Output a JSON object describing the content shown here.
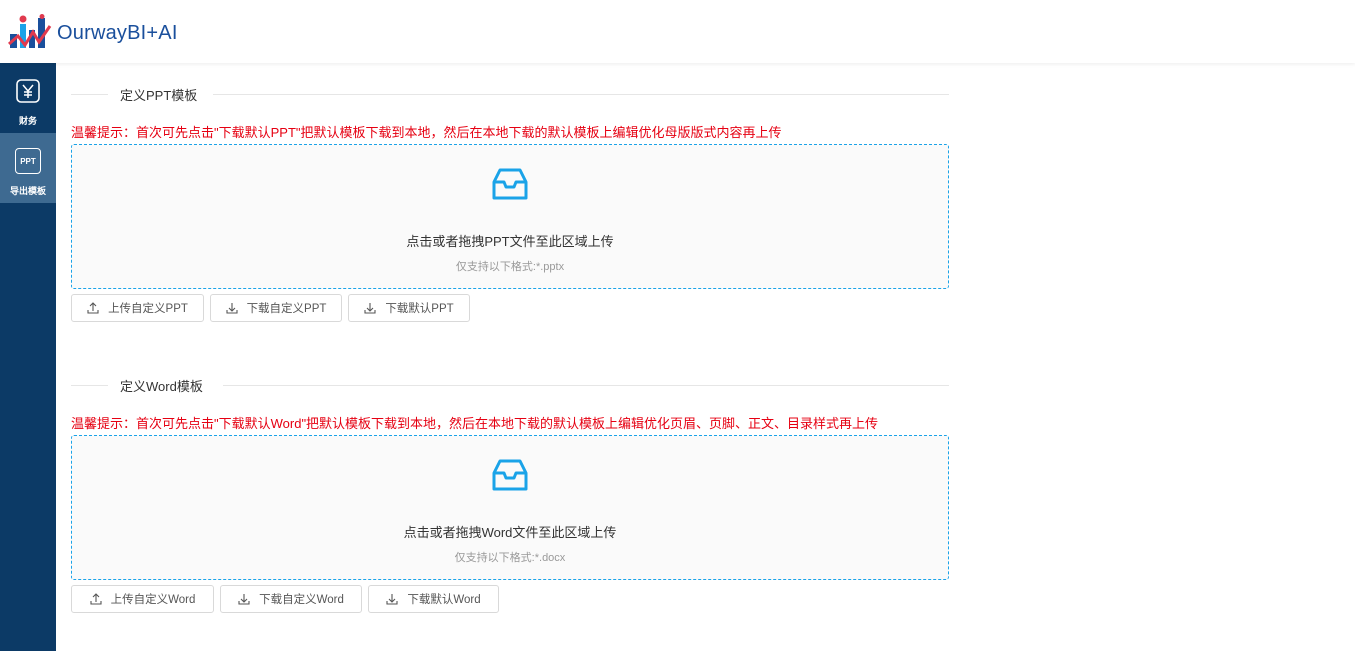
{
  "app": {
    "title": "OurwayBI+AI"
  },
  "sidebar": {
    "items": [
      {
        "label": "财务",
        "icon": "yuan-icon"
      },
      {
        "label": "导出模板",
        "icon": "ppt-icon",
        "icon_text": "PPT"
      }
    ]
  },
  "ppt_section": {
    "title": "定义PPT模板",
    "tip": "温馨提示：首次可先点击\"下载默认PPT\"把默认模板下载到本地，然后在本地下载的默认模板上编辑优化母版版式内容再上传",
    "upload_text": "点击或者拖拽PPT文件至此区域上传",
    "upload_hint": "仅支持以下格式:*.pptx",
    "buttons": [
      "上传自定义PPT",
      "下载自定义PPT",
      "下载默认PPT"
    ]
  },
  "word_section": {
    "title": "定义Word模板",
    "tip": "温馨提示：首次可先点击\"下载默认Word\"把默认模板下载到本地，然后在本地下载的默认模板上编辑优化页眉、页脚、正文、目录样式再上传",
    "upload_text": "点击或者拖拽Word文件至此区域上传",
    "upload_hint": "仅支持以下格式:*.docx",
    "buttons": [
      "上传自定义Word",
      "下载自定义Word",
      "下载默认Word"
    ]
  },
  "colors": {
    "sidebar_bg": "#0c3a66",
    "sidebar_active": "#3e6a91",
    "accent": "#1aa3e8",
    "tip_red": "#e60012",
    "brand_blue": "#1a4f9c"
  }
}
